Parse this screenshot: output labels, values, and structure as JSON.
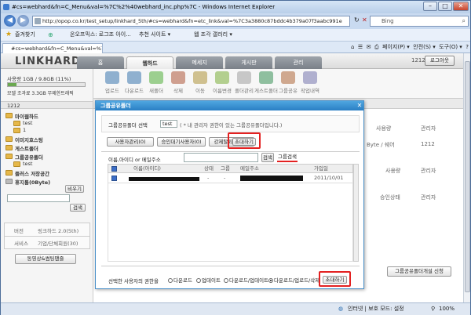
{
  "browser": {
    "title": "#cs=webhard&fn=C_Menu&val=%7C%2%40webhard_inc.php%7C - Windows Internet Explorer",
    "address": "http://opop.co.kr/test_setup/linkhard_5th/#cs=webhard&fn=etc_link&val=%7C3a3880c87bddc4b379a07f3aabc991e",
    "search_placeholder": "Bing",
    "favorites_label": "즐겨찾기",
    "fav_links": [
      "온오프믹스: 로그조 아이...",
      "추천 사이트 ▾",
      "웹 조각 갤러리 ▾"
    ],
    "tab_label": "#cs=webhard&fn=C_Menu&val=%7C%2%40we...",
    "tools": [
      "페이지(P) ▾",
      "안전(S) ▾",
      "도구(O) ▾"
    ],
    "status_text": "인터넷 | 보호 모드: 설정",
    "zoom": "100%"
  },
  "site": {
    "logo": "LINKHARD",
    "nav_tabs": [
      "홈",
      "웹하드",
      "메세지",
      "게시판",
      "관리"
    ],
    "active_tab": "웹하드",
    "user_id": "1212",
    "logout_label": "로그아웃"
  },
  "sidebar": {
    "usage_text": "사용량 1GB / 9.8GB (11%)",
    "usage_fraction": 0.11,
    "capacity_text": "모델 조과료 3.3GB 무제한트래픽",
    "user_header": "1212",
    "tree": {
      "my_webhard": "마이웹하드",
      "my_sub": [
        "test",
        "1"
      ],
      "image_host": "이미지호스팅",
      "guest_folder": "게스트폴더",
      "group_share": "그룹공유폴더",
      "group_sub": [
        "test"
      ],
      "plus_storage": "플러스 저장공간",
      "trash": "휴지통(0Byte)",
      "empty_btn": "비우기"
    },
    "search_btn": "검색",
    "info_labels": [
      "버전",
      "서비스"
    ],
    "info_values": [
      "링크하드 2.0(5th)",
      "기업/단체회원(30)"
    ],
    "sync_btn": "동영상&썸팅팬즐"
  },
  "toolbar_items": [
    "업로드",
    "다운로드",
    "새폴더",
    "삭제",
    "이동",
    "이름변경",
    "폴더관리",
    "게스트폴더",
    "그룹공유",
    "작업내역"
  ],
  "right_panel": {
    "col_admin": "관리자",
    "col_usage": "사용량",
    "usage_value": "Byte / 쉐어",
    "admin_value": "1212",
    "col_user": "사용량",
    "col_admin2": "관리자",
    "col_status": "승인상태",
    "col_admin3": "관리자",
    "create_btn": "그룹공유폴더개설 신청"
  },
  "dialog": {
    "title": "그룹공유폴더",
    "select_label": "그룹공유폴더 선택",
    "select_value": "test",
    "select_note": "( * 내 관리자 권한이 있는 그룹공유폴더입니다.)",
    "tabs": [
      "사용자관리(0)",
      "승인대기사용자(0)",
      "강제탈퇴회원(0)",
      "초대하기"
    ],
    "search_label": "이름,아이디 or 메일주소",
    "search_btn": "검색",
    "group_search_btn": "그룹검색",
    "columns": [
      "이름(아이디)",
      "상태",
      "그룹",
      "메일주소",
      "가입일"
    ],
    "row": {
      "status": "-",
      "group": "-",
      "joined": "2011/10/01"
    },
    "perm_label": "선택한 사용자의 권한을",
    "perm_options": [
      "다운로드",
      "업데이트",
      "다운로드/업데이트",
      "다운로드/업로드/삭제"
    ],
    "selected_perm": "다운로드/업로드/삭제",
    "invite_btn": "초대하기"
  },
  "colors": {
    "highlight": "#e32121",
    "dialog_title": "#2a7fc4",
    "nav_tab": "#7a8088"
  }
}
